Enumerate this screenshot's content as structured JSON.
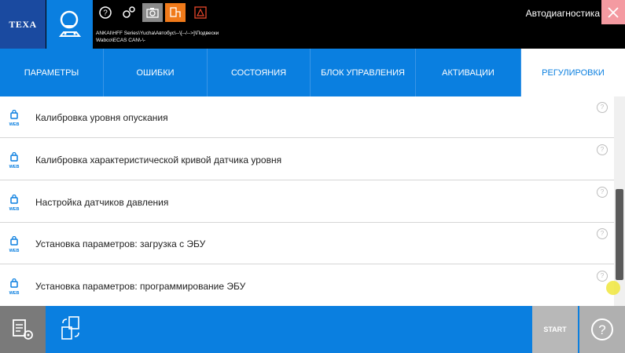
{
  "header": {
    "logo": "TEXA",
    "path_line1": "ANKAI\\HFF Series\\Yucha\\Автобус\\--\\[--/-->]\\Подвески",
    "path_line2": "Wabco\\ECAS CAN\\-\\-",
    "app_title": "Автодиагностика"
  },
  "tabs": [
    {
      "label": "ПАРАМЕТРЫ"
    },
    {
      "label": "ОШИБКИ"
    },
    {
      "label": "СОСТОЯНИЯ"
    },
    {
      "label": "БЛОК УПРАВЛЕНИЯ"
    },
    {
      "label": "АКТИВАЦИИ"
    },
    {
      "label": "РЕГУЛИРОВКИ",
      "active": true
    }
  ],
  "items": [
    {
      "label": "Калибровка уровня опускания"
    },
    {
      "label": "Калибровка характеристической кривой датчика уровня"
    },
    {
      "label": "Настройка датчиков давления"
    },
    {
      "label": "Установка параметров: загрузка с ЭБУ"
    },
    {
      "label": "Установка параметров: программирование ЭБУ"
    }
  ],
  "web_badge": "WEB",
  "help_glyph": "?",
  "bottom": {
    "start_label": "START"
  },
  "colors": {
    "accent": "#0a7fe0",
    "header_bg": "#000000",
    "close_bg": "#f49aa1",
    "diag_orange": "#f07a1a"
  }
}
